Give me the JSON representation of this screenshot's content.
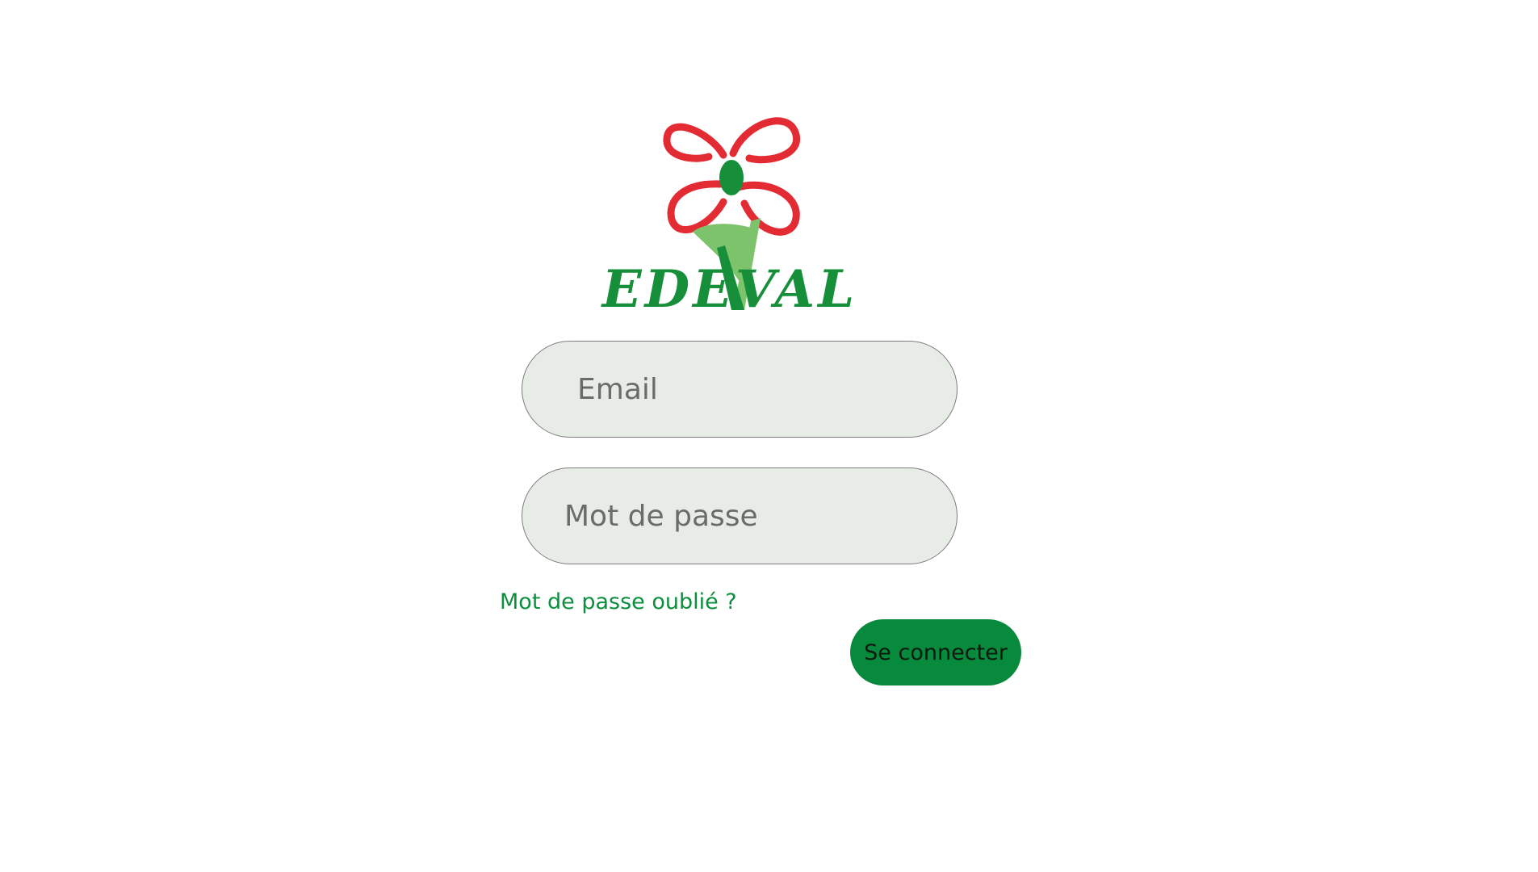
{
  "logo": {
    "text": "EDEVAL",
    "colors": {
      "petal": "#e32b33",
      "green": "#178f3a",
      "light_green": "#7dc36b"
    }
  },
  "form": {
    "email_placeholder": "Email",
    "email_value": "",
    "password_placeholder": "Mot de passe",
    "password_value": "",
    "forgot_password_label": "Mot de passe oublié ?",
    "submit_label": "Se connecter"
  },
  "colors": {
    "accent": "#078a3c",
    "link": "#0b8f3c",
    "field_background": "#e8ece6"
  }
}
